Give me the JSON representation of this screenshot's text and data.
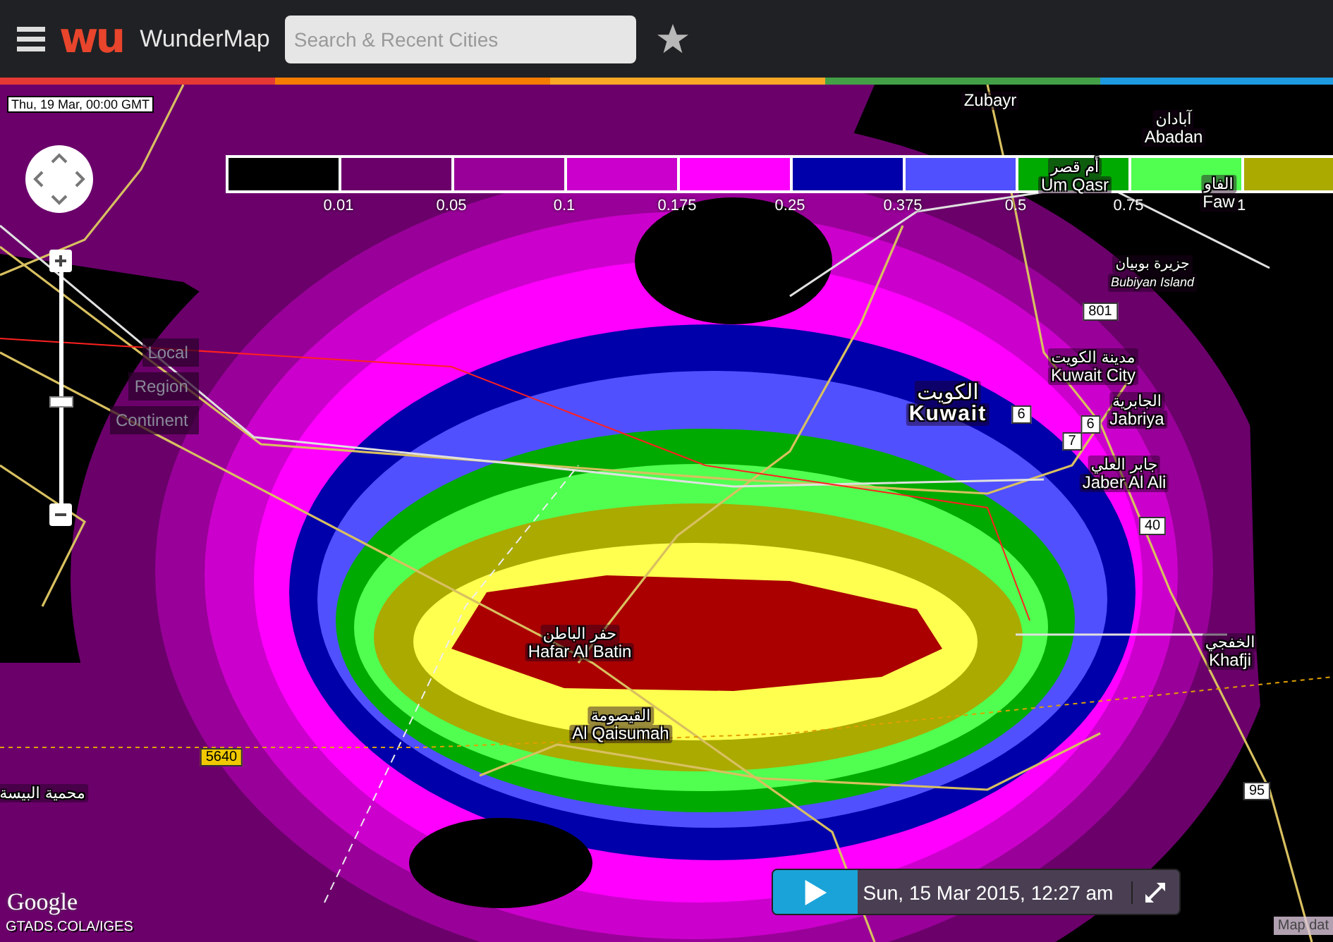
{
  "header": {
    "logo": "wu",
    "title": "WunderMap",
    "search": {
      "placeholder": "Search & Recent Cities"
    }
  },
  "map": {
    "timestamp": "Thu, 19 Mar, 00:00 GMT",
    "legend": {
      "swatches": [
        {
          "color": "#000000"
        },
        {
          "color": "#6b006b"
        },
        {
          "color": "#990099"
        },
        {
          "color": "#cc00cc"
        },
        {
          "color": "#ff00ff"
        },
        {
          "color": "#0000aa"
        },
        {
          "color": "#5050ff"
        },
        {
          "color": "#00aa00"
        },
        {
          "color": "#50ff50"
        },
        {
          "color": "#aaaa00"
        }
      ],
      "ticks": [
        "0.01",
        "0.05",
        "0.1",
        "0.175",
        "0.25",
        "0.375",
        "0.5",
        "0.75",
        "1"
      ]
    },
    "zoom": {
      "level": 0.44,
      "presets": [
        "Local",
        "Region",
        "Continent"
      ]
    },
    "places": [
      {
        "kind": "city",
        "name": "Zubayr"
      },
      {
        "kind": "city",
        "native": "آبادان",
        "name": "Abadan"
      },
      {
        "kind": "city",
        "native": "أم قصر",
        "name": "Um Qasr"
      },
      {
        "kind": "city",
        "native": "الفاو",
        "name": "Faw"
      },
      {
        "kind": "island",
        "native": "جزيرة بوبيان",
        "name": "Bubiyan Island"
      },
      {
        "kind": "city",
        "native": "مدينة الكويت",
        "name": "Kuwait City"
      },
      {
        "kind": "country",
        "native": "الكويت",
        "name": "Kuwait"
      },
      {
        "kind": "city",
        "native": "الجابرية",
        "name": "Jabriya"
      },
      {
        "kind": "city",
        "native": "جابر العلي",
        "name": "Jaber Al Ali"
      },
      {
        "kind": "city",
        "native": "الخفجي",
        "name": "Khafji"
      },
      {
        "kind": "city",
        "native": "حفر الباطن",
        "name": "Hafar Al Batin"
      },
      {
        "kind": "city",
        "native": "القيصومة",
        "name": "Al Qaisumah"
      },
      {
        "kind": "city",
        "native": "محمية البيسة"
      }
    ],
    "road_shields": [
      {
        "kind": "plain",
        "label": "801"
      },
      {
        "kind": "plain",
        "label": "6"
      },
      {
        "kind": "plain",
        "label": "6"
      },
      {
        "kind": "plain",
        "label": "7"
      },
      {
        "kind": "plain",
        "label": "40"
      },
      {
        "kind": "plain",
        "label": "95"
      },
      {
        "kind": "highway",
        "label": "5640"
      }
    ],
    "attribution": {
      "logo": "Google",
      "credit": "GTADS.COLA/IGES",
      "map_data": "Map dat"
    },
    "player": {
      "playing": false,
      "date": "Sun, 15 Mar 2015, 12:27 am"
    }
  }
}
